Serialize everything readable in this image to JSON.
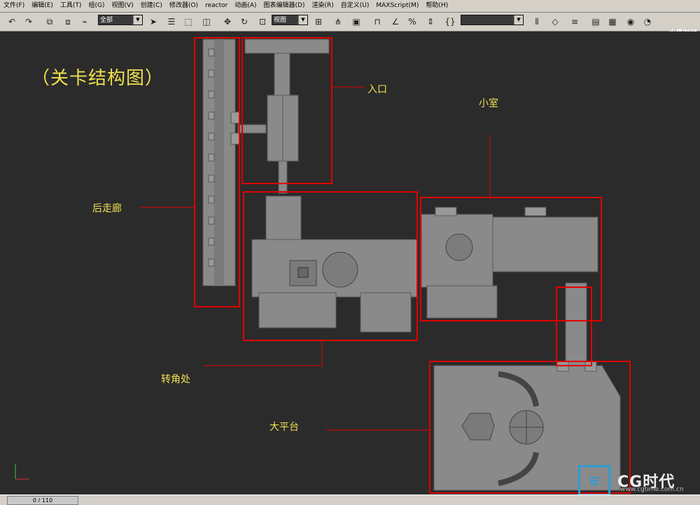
{
  "menu": [
    "文件(F)",
    "编辑(E)",
    "工具(T)",
    "组(G)",
    "视图(V)",
    "创建(C)",
    "修改器(O)",
    "reactor",
    "动画(A)",
    "图表编辑器(D)",
    "渲染(R)",
    "自定义(U)",
    "MAXScript(M)",
    "帮助(H)"
  ],
  "toolbar": {
    "selection_filter": "全部",
    "ref_coord": "视图",
    "named_selection": ""
  },
  "brand_top": "火星时代",
  "title": "（关卡结构图）",
  "labels": {
    "entrance": "入口",
    "back_corridor": "后走廊",
    "small_room": "小室",
    "corner": "转角处",
    "platform": "大平台"
  },
  "status": {
    "frame": "0 / 110"
  },
  "watermark": {
    "brand": "CG时代",
    "url": "www.cgtime.com.cn"
  },
  "colors": {
    "highlight": "#e00000",
    "label": "#f0e050",
    "viewport_bg": "#2b2b2b",
    "geometry": "#8a8a8a"
  }
}
